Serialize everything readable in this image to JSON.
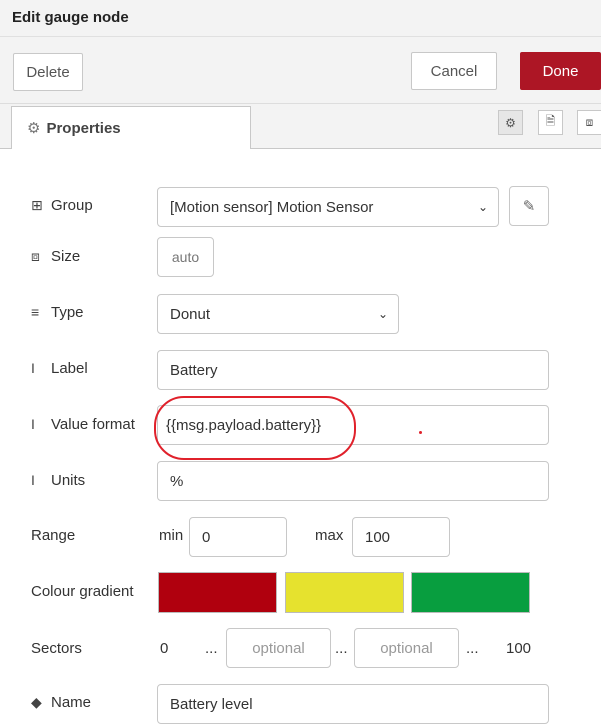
{
  "dialog": {
    "title": "Edit gauge node"
  },
  "buttons": {
    "delete": "Delete",
    "cancel": "Cancel",
    "done": "Done"
  },
  "tabs": {
    "properties": "Properties"
  },
  "icons": {
    "gear": "⚙",
    "group": "⊞",
    "size": "⧈",
    "type": "≡",
    "text": "I",
    "tag": "◆",
    "chevron": "⌄",
    "pencil": "✎",
    "doc": "🗎"
  },
  "form": {
    "group": {
      "label": "Group",
      "value": "[Motion sensor] Motion Sensor"
    },
    "size": {
      "label": "Size",
      "value": "auto"
    },
    "type": {
      "label": "Type",
      "value": "Donut"
    },
    "label": {
      "label": "Label",
      "value": "Battery"
    },
    "value_format": {
      "label": "Value format",
      "value": "{{msg.payload.battery}}"
    },
    "units": {
      "label": "Units",
      "value": "%"
    },
    "range": {
      "label": "Range",
      "min_label": "min",
      "min": "0",
      "max_label": "max",
      "max": "100"
    },
    "colour_gradient": {
      "label": "Colour gradient",
      "colors": [
        "#b0000e",
        "#e6e22e",
        "#089e3f"
      ]
    },
    "sectors": {
      "label": "Sectors",
      "start": "0",
      "sep": "...",
      "placeholder": "optional",
      "end": "100"
    },
    "name": {
      "label": "Name",
      "value": "Battery level"
    }
  }
}
